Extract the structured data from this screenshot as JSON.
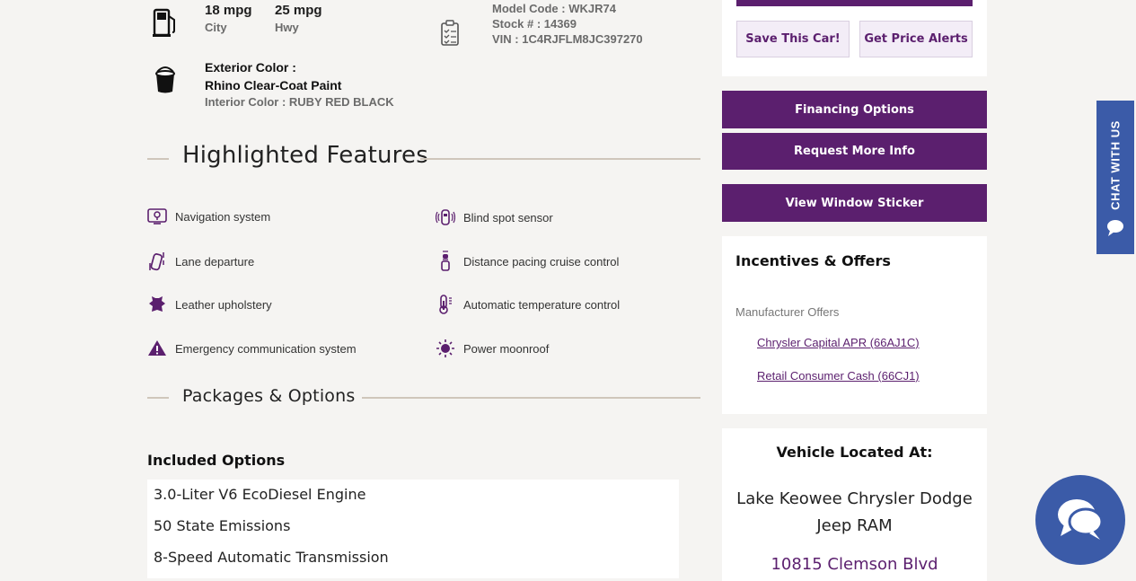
{
  "specs": {
    "city_mpg": "18 mpg",
    "city_label": "City",
    "hwy_mpg": "25 mpg",
    "hwy_label": "Hwy",
    "model_code": "Model Code : WKJR74",
    "stock": "Stock # : 14369",
    "vin": "VIN : 1C4RJFLM8JC397270",
    "exterior_label": "Exterior Color :",
    "exterior_value": "Rhino Clear-Coat Paint",
    "interior": "Interior Color : RUBY RED BLACK"
  },
  "highlighted": {
    "title": "Highlighted Features",
    "features": [
      {
        "label": "Navigation system",
        "icon": "navigation-icon"
      },
      {
        "label": "Blind spot sensor",
        "icon": "blind-spot-icon"
      },
      {
        "label": "Lane departure",
        "icon": "lane-departure-icon"
      },
      {
        "label": "Distance pacing cruise control",
        "icon": "cruise-control-icon"
      },
      {
        "label": "Leather upholstery",
        "icon": "leather-icon"
      },
      {
        "label": "Automatic temperature control",
        "icon": "thermometer-icon"
      },
      {
        "label": "Emergency communication system",
        "icon": "warning-icon"
      },
      {
        "label": "Power moonroof",
        "icon": "sun-icon"
      }
    ]
  },
  "packages": {
    "title": "Packages & Options",
    "included_heading": "Included Options",
    "options": [
      "3.0-Liter V6 EcoDiesel Engine",
      "50 State Emissions",
      "8-Speed Automatic Transmission"
    ]
  },
  "sidebar": {
    "save_label": "Save This Car!",
    "alerts_label": "Get Price Alerts",
    "financing_label": "Financing Options",
    "request_label": "Request More Info",
    "sticker_label": "View Window Sticker",
    "incentives_title": "Incentives & Offers",
    "manufacturer_offers": "Manufacturer Offers",
    "offers": [
      "Chrysler Capital APR (66AJ1C)",
      "Retail Consumer Cash (66CJ1)"
    ],
    "located_title": "Vehicle Located At:",
    "dealer_name": "Lake Keowee Chrysler Dodge Jeep RAM",
    "dealer_address": "10815 Clemson Blvd"
  },
  "chat": {
    "tab_label": "CHAT WITH US"
  },
  "colors": {
    "accent": "#5b1f6e",
    "chat_blue": "#3b5ba8"
  }
}
